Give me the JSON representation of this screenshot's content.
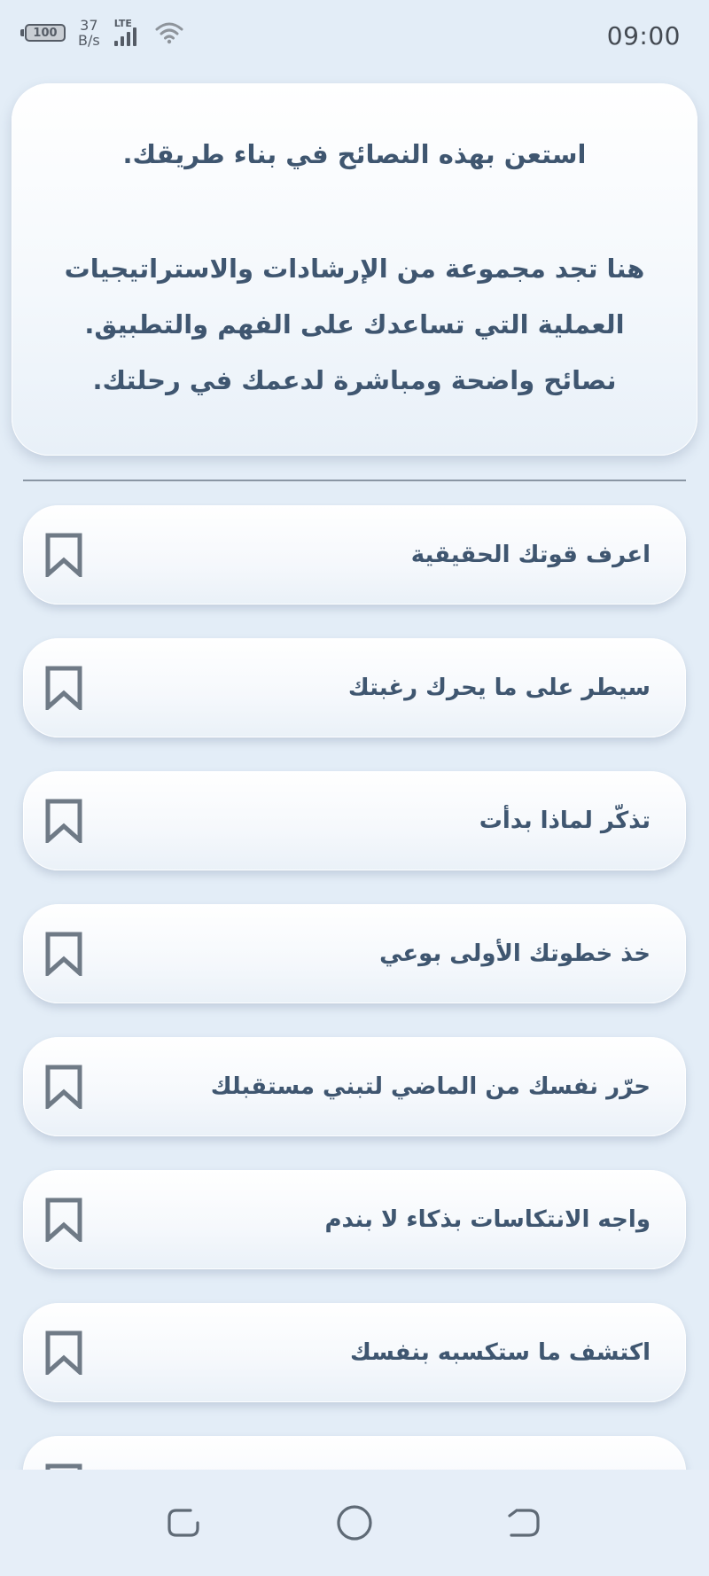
{
  "status_bar": {
    "battery": "100",
    "speed_value": "37",
    "speed_unit": "B/s",
    "network": "LTE",
    "time": "09:00"
  },
  "intro": {
    "title": "استعن بهذه النصائح في بناء طريقك.",
    "body": "هنا تجد مجموعة من الإرشادات والاستراتيجيات العملية التي تساعدك على الفهم والتطبيق. نصائح واضحة ومباشرة لدعمك في رحلتك."
  },
  "tips": [
    {
      "label": "اعرف قوتك الحقيقية"
    },
    {
      "label": "سيطر على ما يحرك رغبتك"
    },
    {
      "label": "تذكّر لماذا بدأت"
    },
    {
      "label": "خذ خطوتك الأولى بوعي"
    },
    {
      "label": "حرّر نفسك من الماضي لتبني مستقبلك"
    },
    {
      "label": "واجه الانتكاسات بذكاء لا بندم"
    },
    {
      "label": "اكتشف ما ستكسبه بنفسك"
    },
    {
      "label": ""
    }
  ],
  "icons": {
    "bookmark": "bookmark-icon",
    "accent": "#3f5670",
    "icon_color": "#6f7a86"
  }
}
